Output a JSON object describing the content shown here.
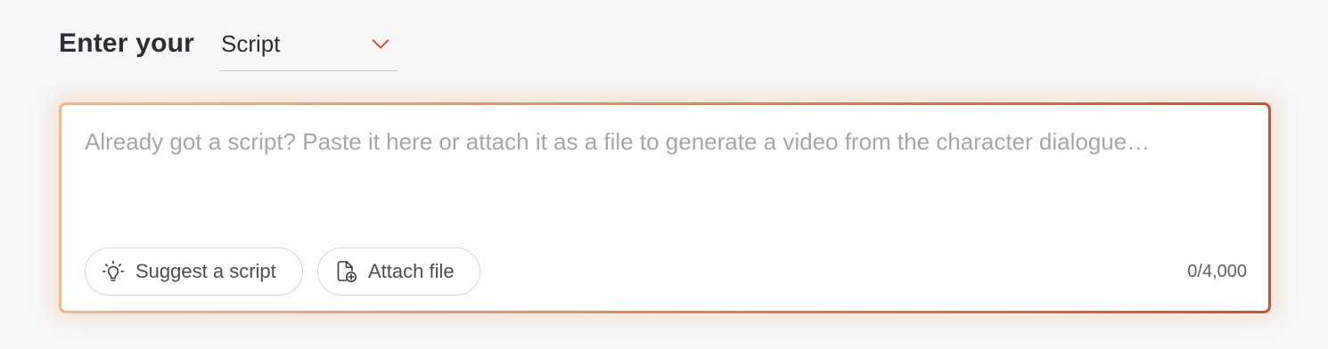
{
  "header": {
    "enter_label": "Enter your",
    "type_select": {
      "value": "Script",
      "icon": "chevron-down-icon",
      "accent_color": "#c8552f"
    }
  },
  "input": {
    "placeholder": "Already got a script? Paste it here or attach it as a file to generate a video from the character dialogue…",
    "value": "",
    "char_count": "0/4,000",
    "border_gradient": [
      "#f0b98a",
      "#e08d5c",
      "#c8552f"
    ]
  },
  "actions": {
    "suggest": {
      "label": "Suggest a script",
      "icon": "lightbulb-icon"
    },
    "attach": {
      "label": "Attach file",
      "icon": "file-plus-icon"
    }
  }
}
